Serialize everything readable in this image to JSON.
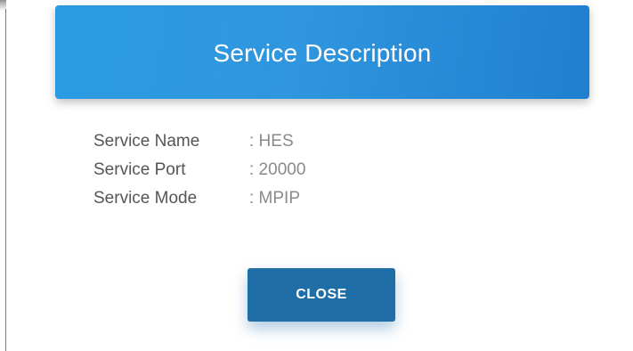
{
  "modal": {
    "title": "Service Description",
    "details": [
      {
        "label": "Service Name",
        "value": ": HES"
      },
      {
        "label": "Service Port",
        "value": ": 20000"
      },
      {
        "label": "Service Mode",
        "value": ": MPIP"
      }
    ],
    "close_label": "CLOSE"
  },
  "colors": {
    "header_blue": "#2a9be2",
    "button_blue": "#1f6ea8"
  }
}
